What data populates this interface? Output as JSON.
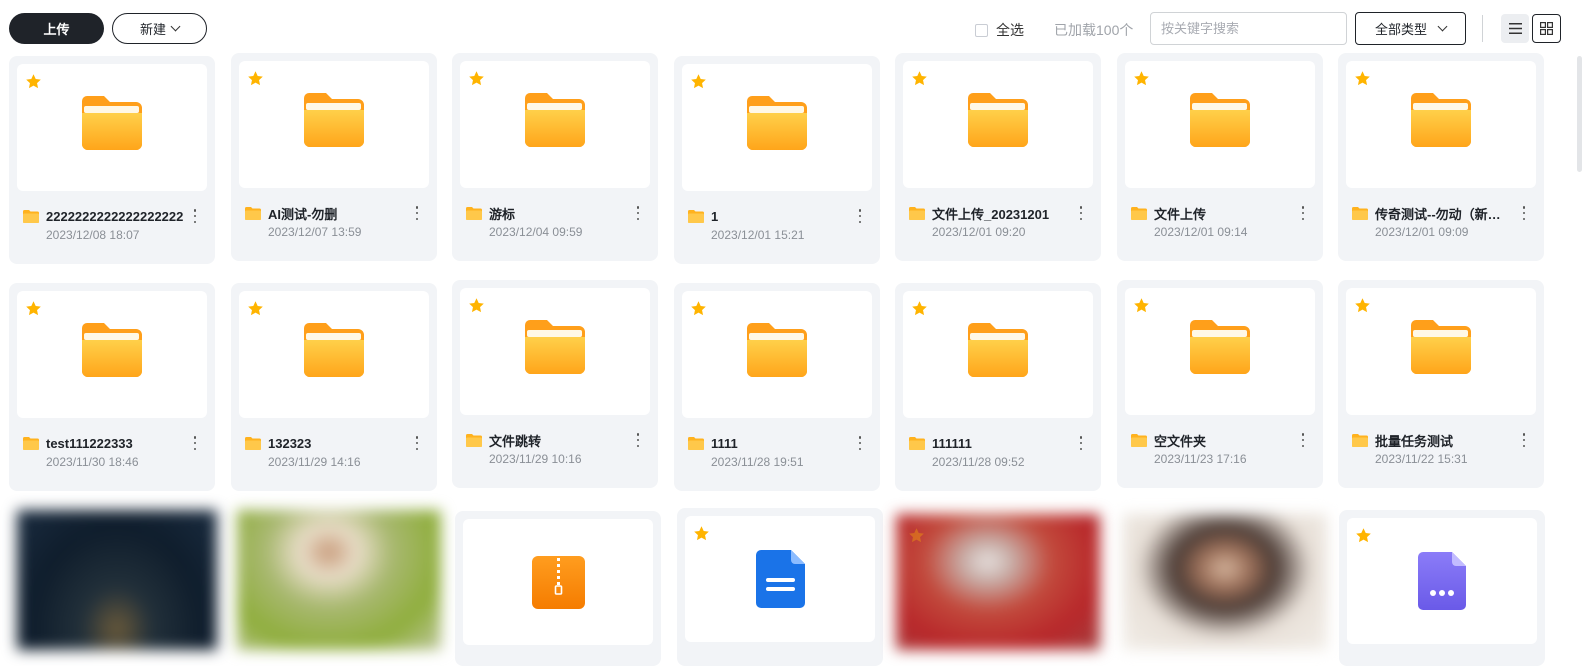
{
  "toolbar": {
    "upload_label": "上传",
    "new_label": "新建",
    "select_all_label": "全选",
    "loaded_text": "已加载100个",
    "search_placeholder": "按关键字搜索",
    "type_filter_label": "全部类型"
  },
  "folders": [
    {
      "name": "2222222222222222222",
      "date": "2023/12/08 18:07",
      "starred": true
    },
    {
      "name": "AI测试-勿删",
      "date": "2023/12/07 13:59",
      "starred": true
    },
    {
      "name": "游标",
      "date": "2023/12/04 09:59",
      "starred": true
    },
    {
      "name": "1",
      "date": "2023/12/01 15:21",
      "starred": true
    },
    {
      "name": "文件上传_20231201",
      "date": "2023/12/01 09:20",
      "starred": true
    },
    {
      "name": "文件上传",
      "date": "2023/12/01 09:14",
      "starred": true
    },
    {
      "name": "传奇测试--勿动（新建）",
      "date": "2023/12/01 09:09",
      "starred": true
    },
    {
      "name": "test111222333",
      "date": "2023/11/30 18:46",
      "starred": true
    },
    {
      "name": "132323",
      "date": "2023/11/29 14:16",
      "starred": true
    },
    {
      "name": "文件跳转",
      "date": "2023/11/29 10:16",
      "starred": true
    },
    {
      "name": "1111",
      "date": "2023/11/28 19:51",
      "starred": true
    },
    {
      "name": "111111",
      "date": "2023/11/28 09:52",
      "starred": true
    },
    {
      "name": "空文件夹",
      "date": "2023/11/23 17:16",
      "starred": true
    },
    {
      "name": "批量任务测试",
      "date": "2023/11/22 15:31",
      "starred": true
    }
  ],
  "files": [
    {
      "kind": "image",
      "icon": "photo-thumbnail",
      "starred": false
    },
    {
      "kind": "image",
      "icon": "photo-thumbnail",
      "starred": false
    },
    {
      "kind": "archive",
      "icon": "zip-icon",
      "starred": false
    },
    {
      "kind": "document",
      "icon": "document-icon",
      "starred": true
    },
    {
      "kind": "image",
      "icon": "photo-thumbnail",
      "starred": true
    },
    {
      "kind": "image",
      "icon": "photo-thumbnail",
      "starred": false
    },
    {
      "kind": "other",
      "icon": "other-file-icon",
      "starred": true
    }
  ],
  "colors": {
    "folder": "#ffb21e",
    "star": "#ffb400",
    "card_bg": "#f2f4f7",
    "doc_blue": "#1a73e8",
    "zip_orange": "#fa8c16",
    "other_purple": "#7a6cf0"
  }
}
